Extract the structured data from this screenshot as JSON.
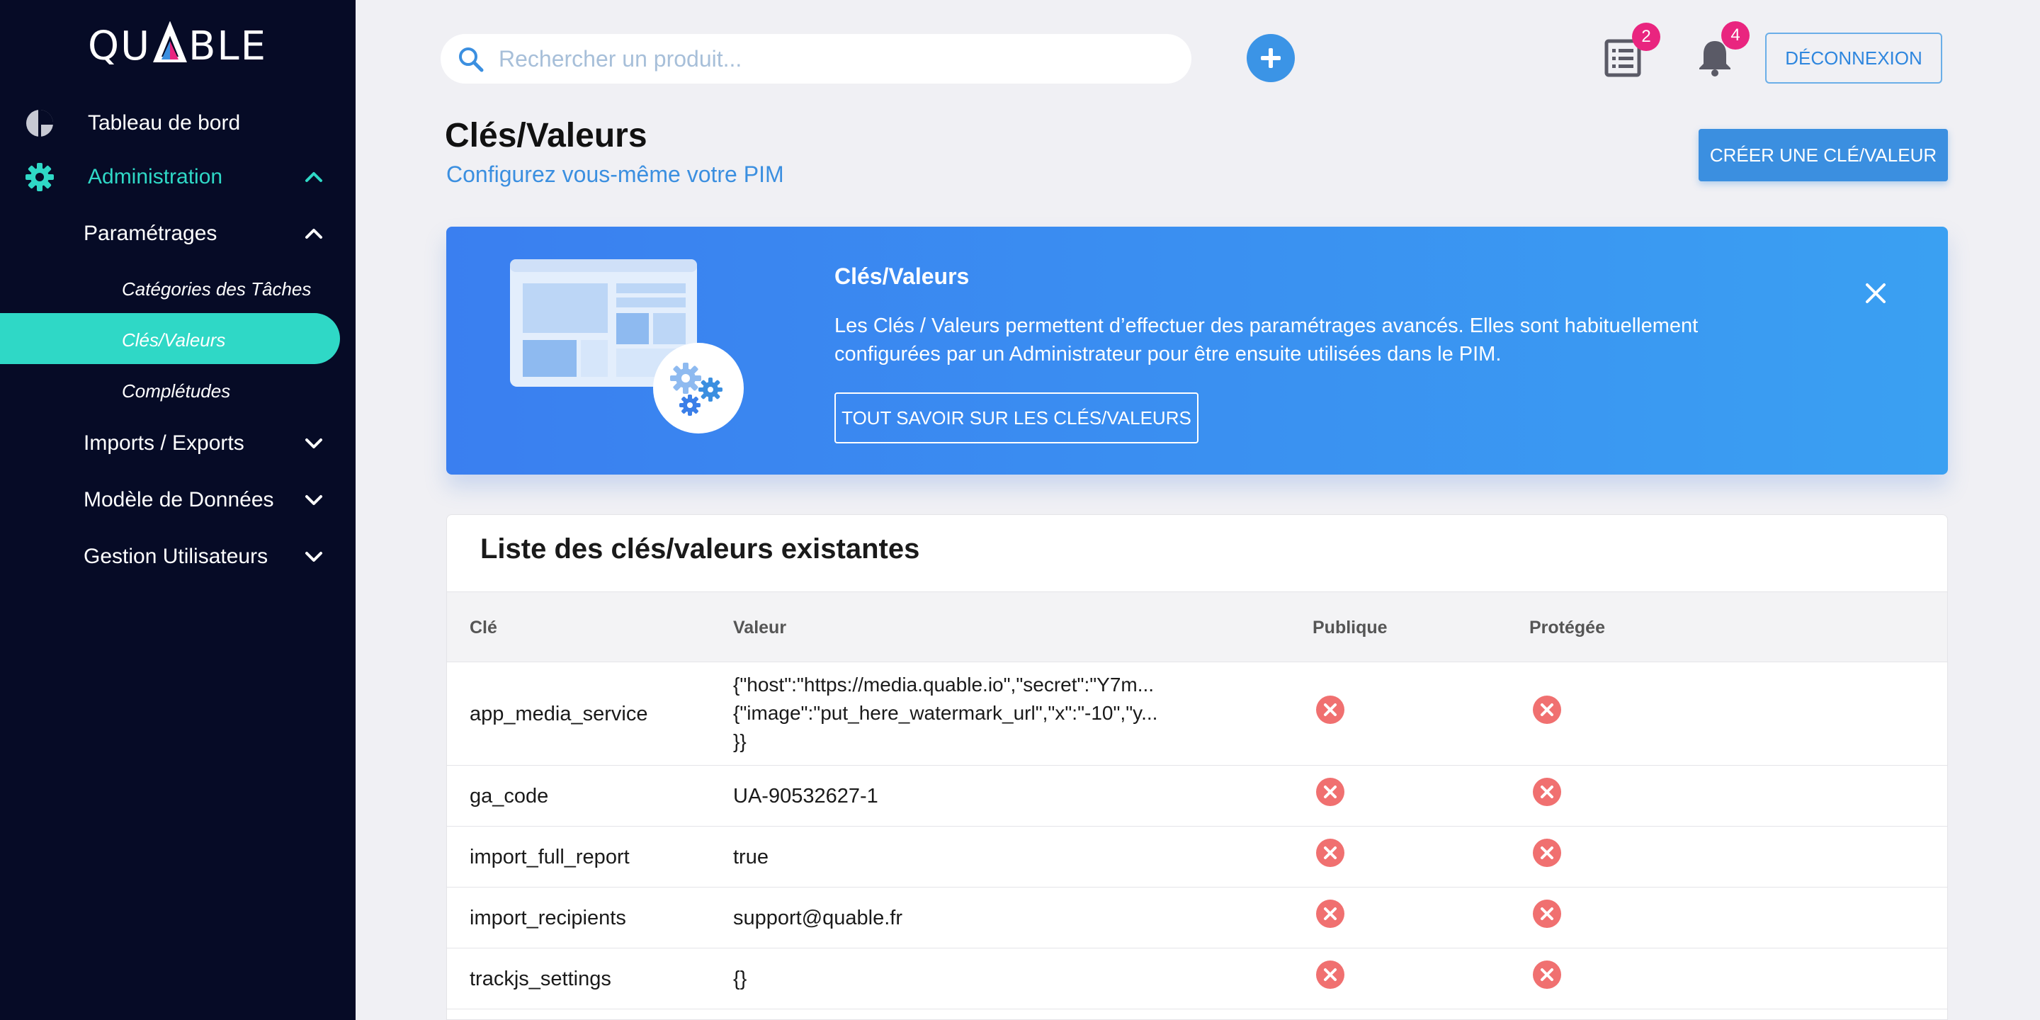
{
  "brand": {
    "logo_text": "QUABLE"
  },
  "sidebar": {
    "dashboard": "Tableau de bord",
    "administration": "Administration",
    "parametrages": "Paramétrages",
    "categories": "Catégories des Tâches",
    "cles_valeurs": "Clés/Valeurs",
    "completudes": "Complétudes",
    "imports_exports": "Imports / Exports",
    "modele": "Modèle de Données",
    "users": "Gestion Utilisateurs"
  },
  "topbar": {
    "search_placeholder": "Rechercher un produit...",
    "tasks_badge": "2",
    "notif_badge": "4",
    "logout_label": "DÉCONNEXION"
  },
  "header": {
    "title": "Clés/Valeurs",
    "subtitle": "Configurez vous-même votre PIM",
    "create_label": "CRÉER UNE CLÉ/VALEUR"
  },
  "banner": {
    "title": "Clés/Valeurs",
    "text": "Les Clés / Valeurs permettent d’effectuer des paramétrages avancés. Elles sont habituellement configurées par un Administrateur pour être ensuite utilisées dans le PIM.",
    "button_label": "TOUT SAVOIR SUR LES CLÉS/VALEURS"
  },
  "table": {
    "title": "Liste des clés/valeurs existantes",
    "columns": [
      "Clé",
      "Valeur",
      "Publique",
      "Protégée"
    ],
    "rows": [
      {
        "key": "app_media_service",
        "value": "{\"host\":\"https://media.quable.io\",\"secret\":\"Y7m...\n{\"image\":\"put_here_watermark_url\",\"x\":\"-10\",\"y...\n}}",
        "public": false,
        "protected": false
      },
      {
        "key": "ga_code",
        "value": "UA-90532627-1",
        "public": false,
        "protected": false
      },
      {
        "key": "import_full_report",
        "value": "true",
        "public": false,
        "protected": false
      },
      {
        "key": "import_recipients",
        "value": "support@quable.fr",
        "public": false,
        "protected": false
      },
      {
        "key": "trackjs_settings",
        "value": "{}",
        "public": false,
        "protected": false
      }
    ]
  },
  "colors": {
    "sidebar_bg": "#060b26",
    "accent_teal": "#2fd8c6",
    "primary_blue": "#3b8fe0",
    "badge_pink": "#e9257f",
    "false_red": "#f07070"
  }
}
